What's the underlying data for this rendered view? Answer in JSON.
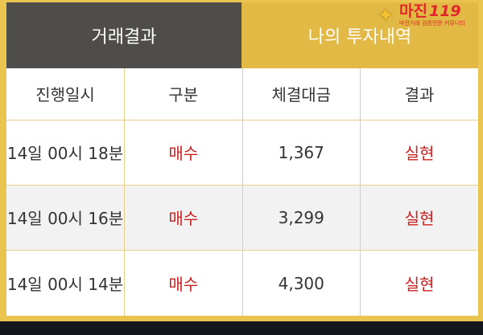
{
  "tabs": [
    {
      "label": "거래결과",
      "active": true
    },
    {
      "label": "나의 투자내역",
      "active": false
    }
  ],
  "logo": {
    "name": "마진",
    "number": "119",
    "tagline": "마진거래 검증전문 커뮤니티"
  },
  "table": {
    "headers": [
      "진행일시",
      "구분",
      "체결대금",
      "결과"
    ],
    "rows": [
      {
        "datetime": "14일 00시 18분",
        "type": "매수",
        "amount": "1,367",
        "result": "실현"
      },
      {
        "datetime": "14일 00시 16분",
        "type": "매수",
        "amount": "3,299",
        "result": "실현"
      },
      {
        "datetime": "14일 00시 14분",
        "type": "매수",
        "amount": "4,300",
        "result": "실현"
      }
    ]
  },
  "colors": {
    "frame": "#e9c44e",
    "active_tab": "#4f4d4b",
    "accent_red": "#cc1f1f",
    "bottom_bar": "#14161d"
  }
}
